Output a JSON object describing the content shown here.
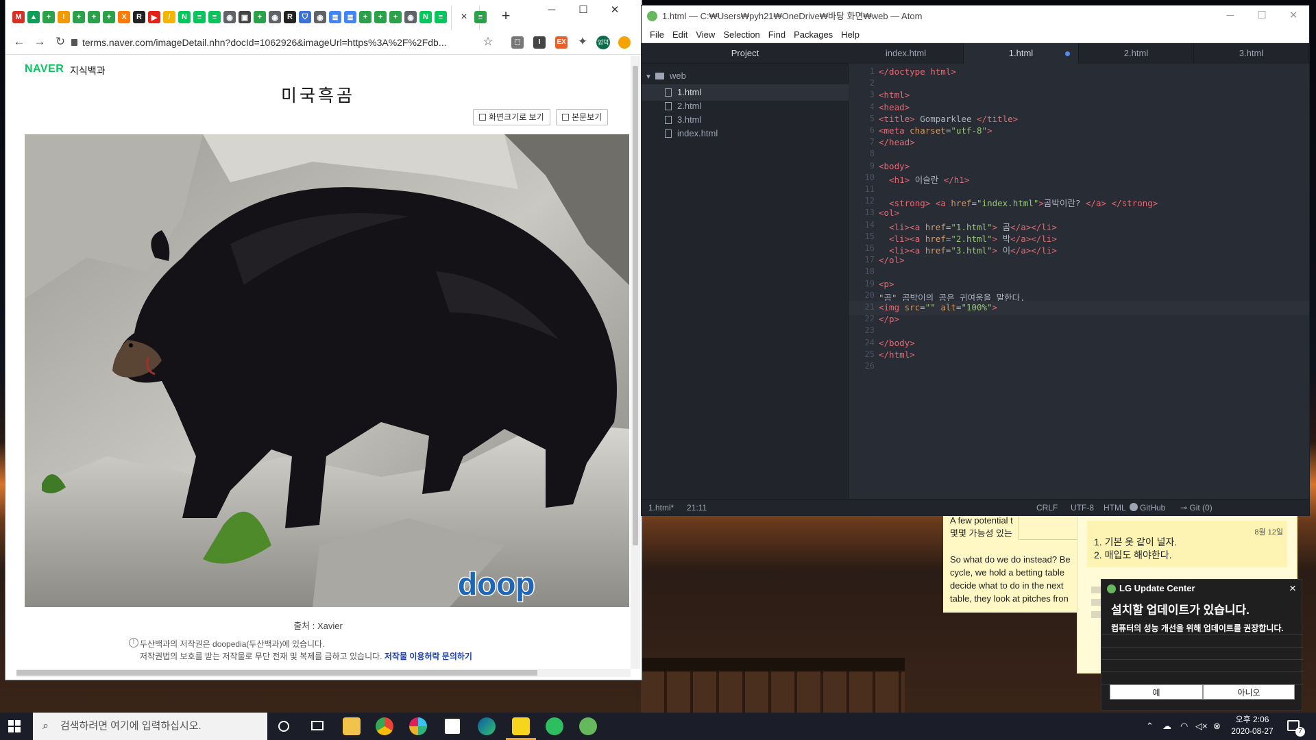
{
  "chrome": {
    "url": "terms.naver.com/imageDetail.nhn?docId=1062926&imageUrl=https%3A%2F%2Fdb...",
    "tab_icons": [
      {
        "label": "M",
        "color": "#d93025"
      },
      {
        "label": "▲",
        "color": "#0f9d58"
      },
      {
        "label": "+",
        "color": "#2aa24a"
      },
      {
        "label": "!",
        "color": "#f29900"
      },
      {
        "label": "+",
        "color": "#2aa24a"
      },
      {
        "label": "+",
        "color": "#2aa24a"
      },
      {
        "label": "+",
        "color": "#2aa24a"
      },
      {
        "label": "X",
        "color": "#ff7a00"
      },
      {
        "label": "R",
        "color": "#222222"
      },
      {
        "label": "▶",
        "color": "#e62117"
      },
      {
        "label": "/",
        "color": "#f4b400"
      },
      {
        "label": "N",
        "color": "#03c75a"
      },
      {
        "label": "≡",
        "color": "#03c75a"
      },
      {
        "label": "≡",
        "color": "#03c75a"
      },
      {
        "label": "◉",
        "color": "#5f6368"
      },
      {
        "label": "▣",
        "color": "#444444"
      },
      {
        "label": "+",
        "color": "#2aa24a"
      },
      {
        "label": "◉",
        "color": "#5f6368"
      },
      {
        "label": "R",
        "color": "#222222"
      },
      {
        "label": "⛉",
        "color": "#3b73d6"
      },
      {
        "label": "◉",
        "color": "#5f6368"
      },
      {
        "label": "≣",
        "color": "#4285f4"
      },
      {
        "label": "≣",
        "color": "#4285f4"
      },
      {
        "label": "+",
        "color": "#2aa24a"
      },
      {
        "label": "+",
        "color": "#2aa24a"
      },
      {
        "label": "+",
        "color": "#2aa24a"
      },
      {
        "label": "◉",
        "color": "#5f6368"
      },
      {
        "label": "N",
        "color": "#03c75a"
      },
      {
        "label": "≡",
        "color": "#03c75a"
      }
    ],
    "profile_label": "엉덕",
    "site_name": "NAVER",
    "site_section": "지식백과",
    "doc_title": "미국흑곰",
    "fullscreen_label": "화면크기로 보기",
    "body_label": "본문보기",
    "caption": "출처 : Xavier",
    "notice_line1": "두산백과의 저작권은 doopedia(두산백과)에 있습니다.",
    "notice_line2": "저작권법의 보호를 받는 저작물로 무단 전재 및 복제를 금하고 있습니다.",
    "notice_link": "저작물 이용허락 문의하기",
    "watermark": "doop"
  },
  "atom": {
    "title": "1.html — C:₩Users₩pyh21₩OneDrive₩바탕 화면₩web — Atom",
    "menu": [
      "File",
      "Edit",
      "View",
      "Selection",
      "Find",
      "Packages",
      "Help"
    ],
    "project_label": "Project",
    "folder": "web",
    "files": [
      "1.html",
      "2.html",
      "3.html",
      "index.html"
    ],
    "tabs": [
      "index.html",
      "1.html",
      "2.html",
      "3.html"
    ],
    "active_tab": 1,
    "lines": [
      [
        [
          "t",
          "</doctype html>"
        ]
      ],
      [],
      [
        [
          "t",
          "<html>"
        ]
      ],
      [
        [
          "t",
          "<head>"
        ]
      ],
      [
        [
          "t",
          "<title>"
        ],
        [
          "p",
          " Gomparklee "
        ],
        [
          "t",
          "</title>"
        ]
      ],
      [
        [
          "t",
          "<meta "
        ],
        [
          "a",
          "charset"
        ],
        [
          "p",
          "="
        ],
        [
          "s",
          "\"utf-8\""
        ],
        [
          "t",
          ">"
        ]
      ],
      [
        [
          "t",
          "</head>"
        ]
      ],
      [],
      [
        [
          "t",
          "<body>"
        ]
      ],
      [
        [
          "p",
          "  "
        ],
        [
          "t",
          "<h1>"
        ],
        [
          "p",
          " 이슬란 "
        ],
        [
          "t",
          "</h1>"
        ]
      ],
      [],
      [
        [
          "p",
          "  "
        ],
        [
          "t",
          "<strong>"
        ],
        [
          "p",
          " "
        ],
        [
          "t",
          "<a "
        ],
        [
          "a",
          "href"
        ],
        [
          "p",
          "="
        ],
        [
          "s",
          "\"index.html\""
        ],
        [
          "t",
          ">"
        ],
        [
          "p",
          "곰박이란? "
        ],
        [
          "t",
          "</a>"
        ],
        [
          "p",
          " "
        ],
        [
          "t",
          "</strong>"
        ]
      ],
      [
        [
          "t",
          "<ol>"
        ]
      ],
      [
        [
          "p",
          "  "
        ],
        [
          "t",
          "<li><a "
        ],
        [
          "a",
          "href"
        ],
        [
          "p",
          "="
        ],
        [
          "s",
          "\"1.html\""
        ],
        [
          "t",
          ">"
        ],
        [
          "p",
          " 곰"
        ],
        [
          "t",
          "</a></li>"
        ]
      ],
      [
        [
          "p",
          "  "
        ],
        [
          "t",
          "<li><a "
        ],
        [
          "a",
          "href"
        ],
        [
          "p",
          "="
        ],
        [
          "s",
          "\"2.html\""
        ],
        [
          "t",
          ">"
        ],
        [
          "p",
          " 박"
        ],
        [
          "t",
          "</a></li>"
        ]
      ],
      [
        [
          "p",
          "  "
        ],
        [
          "t",
          "<li><a "
        ],
        [
          "a",
          "href"
        ],
        [
          "p",
          "="
        ],
        [
          "s",
          "\"3.html\""
        ],
        [
          "t",
          ">"
        ],
        [
          "p",
          " 이"
        ],
        [
          "t",
          "</a></li>"
        ]
      ],
      [
        [
          "t",
          "</ol>"
        ]
      ],
      [],
      [
        [
          "t",
          "<p>"
        ]
      ],
      [
        [
          "p",
          "\"곰\" 곰박이의 곰은 귀여움을 말한다."
        ]
      ],
      [
        [
          "t",
          "<img "
        ],
        [
          "a",
          "src"
        ],
        [
          "p",
          "="
        ],
        [
          "s",
          "\"\""
        ],
        [
          "p",
          " "
        ],
        [
          "a",
          "alt"
        ],
        [
          "p",
          "="
        ],
        [
          "s",
          "\"100%\""
        ],
        [
          "t",
          ">"
        ]
      ],
      [
        [
          "t",
          "</p>"
        ]
      ],
      [],
      [
        [
          "t",
          "</body>"
        ]
      ],
      [
        [
          "t",
          "</html>"
        ]
      ],
      []
    ],
    "current_line": 21,
    "status_file": "1.html*",
    "status_pos": "21:11",
    "status_right": [
      "CRLF",
      "UTF-8",
      "HTML",
      "GitHub",
      "Git (0)"
    ]
  },
  "notes": {
    "note1_lines": [
      "A few potential t",
      "몇몇 가능성 있는",
      "",
      "So what do we do instead? Be",
      "cycle, we hold a betting table",
      "decide what to do in the next",
      "table, they look at pitches fron"
    ],
    "note2_date": "8월 12일",
    "note2_items": [
      "1. 기본 옷 같이 널자.",
      "2. 매입도 해야한다."
    ]
  },
  "toast": {
    "app": "LG Update Center",
    "headline": "설치할 업데이트가 있습니다.",
    "body": "컴퓨터의 성능 개선을 위해 업데이트를 권장합니다.",
    "yes": "예",
    "no": "아니오",
    "close": "×"
  },
  "taskbar": {
    "search_placeholder": "검색하려면 여기에 입력하십시오.",
    "time": "오후 2:06",
    "date": "2020-08-27",
    "notification_count": "7"
  }
}
